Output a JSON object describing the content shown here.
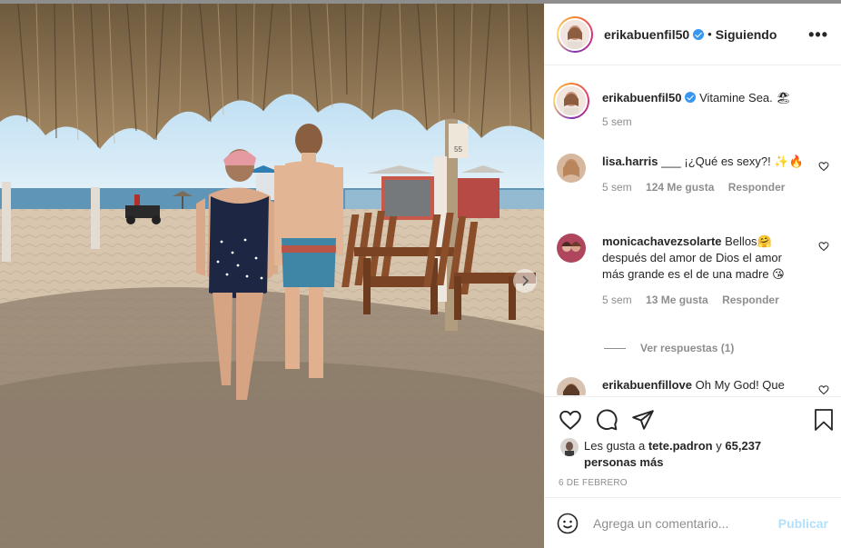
{
  "post": {
    "author": "erikabuenfil50",
    "follow_dot": "•",
    "follow_status": "Siguiendo",
    "more": "•••"
  },
  "caption": {
    "author": "erikabuenfil50",
    "text": "Vitamine Sea. 🏖",
    "time": "5 sem"
  },
  "comments": [
    {
      "user": "lisa.harris",
      "text": "___ ¡¿Qué es sexy?! ✨🔥",
      "time": "5 sem",
      "likes": "124 Me gusta",
      "reply": "Responder"
    },
    {
      "user": "monicachavezsolarte",
      "text": "Bellos🤗 después del amor de Dios el amor más grande es el de una madre 😘",
      "time": "5 sem",
      "likes": "13 Me gusta",
      "reply": "Responder",
      "view_replies": "Ver respuestas (1)"
    },
    {
      "user": "erikabuenfillove",
      "text": "Oh My God! Que"
    }
  ],
  "likes": {
    "prefix": "Les gusta a",
    "user": "tete.padron",
    "connector": "y",
    "count": "65,237 personas más"
  },
  "date": "6 DE FEBRERO",
  "composer": {
    "placeholder": "Agrega un comentario...",
    "publish": "Publicar"
  },
  "icons": {
    "like": "heart-icon",
    "comment": "comment-icon",
    "share": "share-icon",
    "save": "bookmark-icon",
    "emoji": "emoji-icon",
    "more": "more-icon",
    "carousel": "chevron-right-icon"
  },
  "colors": {
    "link_blue": "#0095f6",
    "publish_disabled": "#b2dffc",
    "verified": "#3897f0",
    "muted": "#8e8e8e"
  }
}
